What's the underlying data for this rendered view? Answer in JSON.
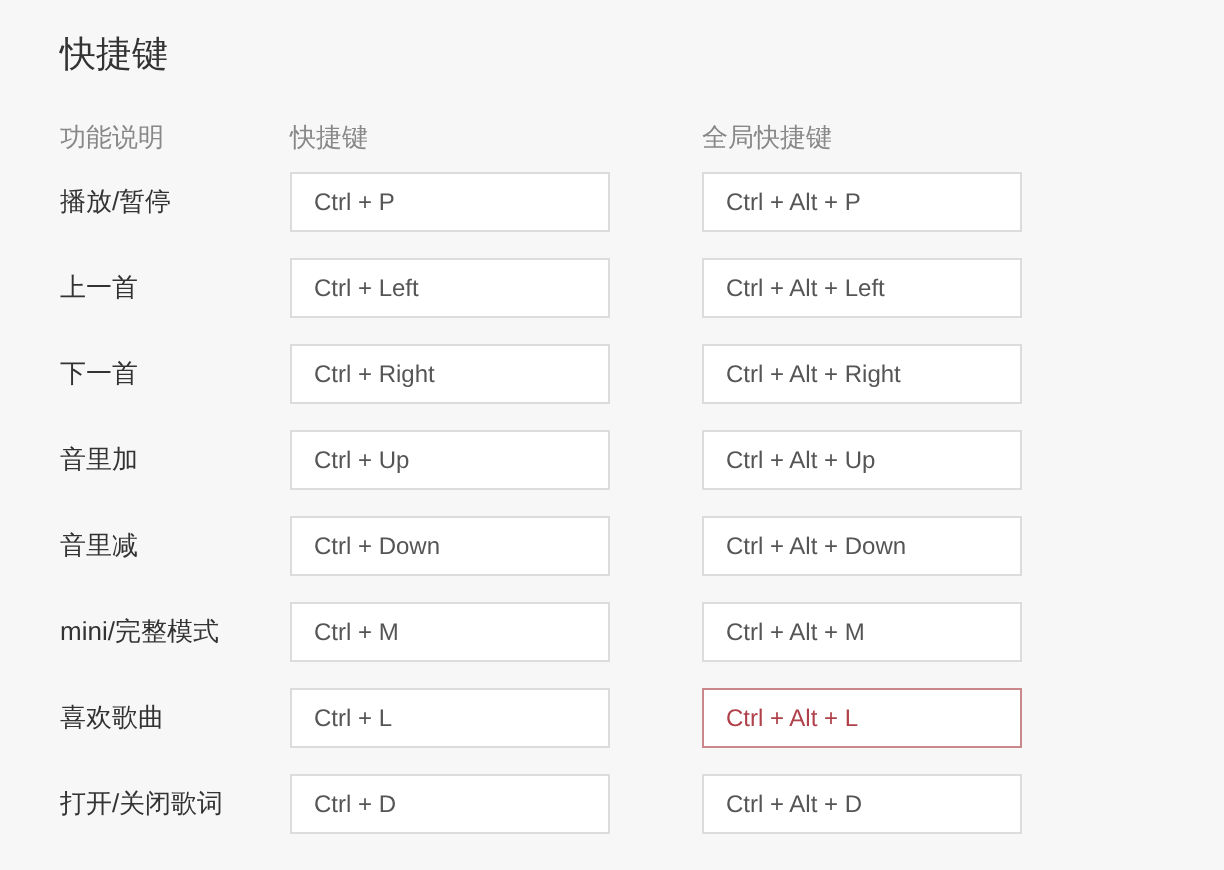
{
  "title": "快捷键",
  "columns": [
    "功能说明",
    "快捷键",
    "全局快捷键"
  ],
  "rows": [
    {
      "label": "播放/暂停",
      "shortcut": {
        "value": "Ctrl + P",
        "conflict": false
      },
      "global": {
        "value": "Ctrl + Alt + P",
        "conflict": false
      }
    },
    {
      "label": "上一首",
      "shortcut": {
        "value": "Ctrl + Left",
        "conflict": false
      },
      "global": {
        "value": "Ctrl + Alt + Left",
        "conflict": false
      }
    },
    {
      "label": "下一首",
      "shortcut": {
        "value": "Ctrl + Right",
        "conflict": false
      },
      "global": {
        "value": "Ctrl + Alt + Right",
        "conflict": false
      }
    },
    {
      "label": "音里加",
      "shortcut": {
        "value": "Ctrl + Up",
        "conflict": false
      },
      "global": {
        "value": "Ctrl + Alt + Up",
        "conflict": false
      }
    },
    {
      "label": "音里减",
      "shortcut": {
        "value": "Ctrl + Down",
        "conflict": false
      },
      "global": {
        "value": "Ctrl + Alt + Down",
        "conflict": false
      }
    },
    {
      "label": "mini/完整模式",
      "shortcut": {
        "value": "Ctrl + M",
        "conflict": false
      },
      "global": {
        "value": "Ctrl + Alt + M",
        "conflict": false
      }
    },
    {
      "label": "喜欢歌曲",
      "shortcut": {
        "value": "Ctrl + L",
        "conflict": false
      },
      "global": {
        "value": "Ctrl + Alt + L",
        "conflict": true
      }
    },
    {
      "label": "打开/关闭歌词",
      "shortcut": {
        "value": "Ctrl + D",
        "conflict": false
      },
      "global": {
        "value": "Ctrl + Alt + D",
        "conflict": false
      }
    }
  ]
}
